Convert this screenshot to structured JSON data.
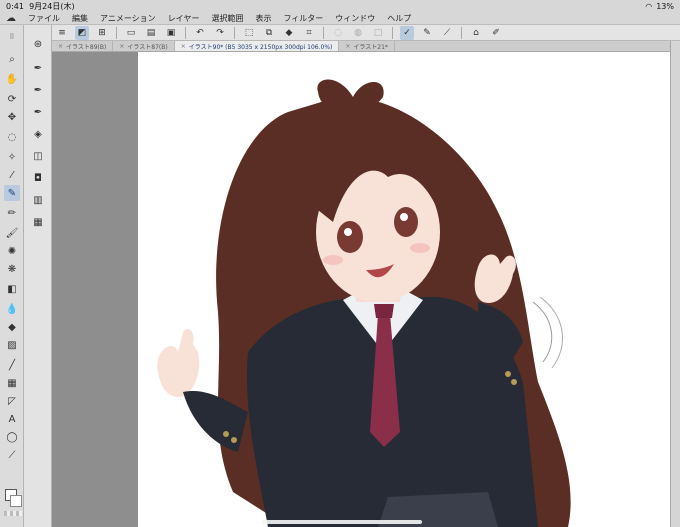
{
  "status_bar": {
    "time": "0:41",
    "date": "9月24日(木)",
    "battery": "13%"
  },
  "menu": [
    "ファイル",
    "編集",
    "アニメーション",
    "レイヤー",
    "選択範囲",
    "表示",
    "フィルター",
    "ウィンドウ",
    "ヘルプ"
  ],
  "tabs": [
    {
      "label": "イラスト89(B)"
    },
    {
      "label": "イラスト87(B)"
    },
    {
      "label": "イラスト90* (B5 3035 x 2150px 300dpi 106.0%)",
      "active": true
    },
    {
      "label": "イラスト21*"
    }
  ],
  "colors": {
    "accent": "#b9c9de",
    "hair": "#5a2e24",
    "blazer": "#262b36",
    "tie": "#8a2e4a"
  }
}
